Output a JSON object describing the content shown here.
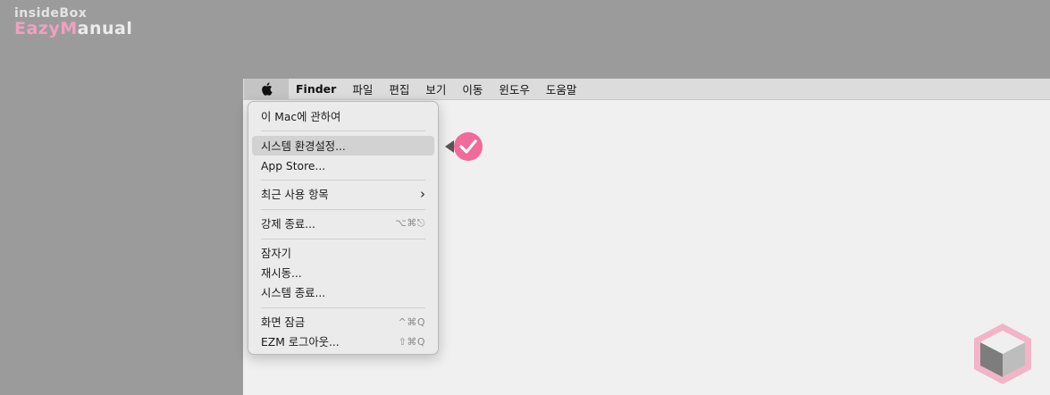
{
  "watermark": {
    "line1": "insideBox",
    "line2_a": "Eazy",
    "line2_b": "M",
    "line2_c": "anual"
  },
  "menubar": {
    "apple_icon": "apple-logo",
    "app_name": "Finder",
    "items": [
      "파일",
      "편집",
      "보기",
      "이동",
      "윈도우",
      "도움말"
    ]
  },
  "apple_menu": {
    "about": "이 Mac에 관하여",
    "system_prefs": "시스템 환경설정...",
    "app_store": "App Store...",
    "recent_items": "최근 사용 항목",
    "force_quit": "강제 종료...",
    "force_quit_shortcut": "⌥⌘⎋",
    "sleep": "잠자기",
    "restart": "재시동...",
    "shutdown": "시스템 종료...",
    "lock_screen": "화면 잠금",
    "lock_screen_shortcut": "^⌘Q",
    "logout": "EZM 로그아웃...",
    "logout_shortcut": "⇧⌘Q",
    "highlighted_item": "시스템 환경설정..."
  },
  "colors": {
    "highlight_marker": "#f06a9a",
    "menu_bg": "#ebebeb",
    "desktop_bg": "#9b9b9b"
  }
}
